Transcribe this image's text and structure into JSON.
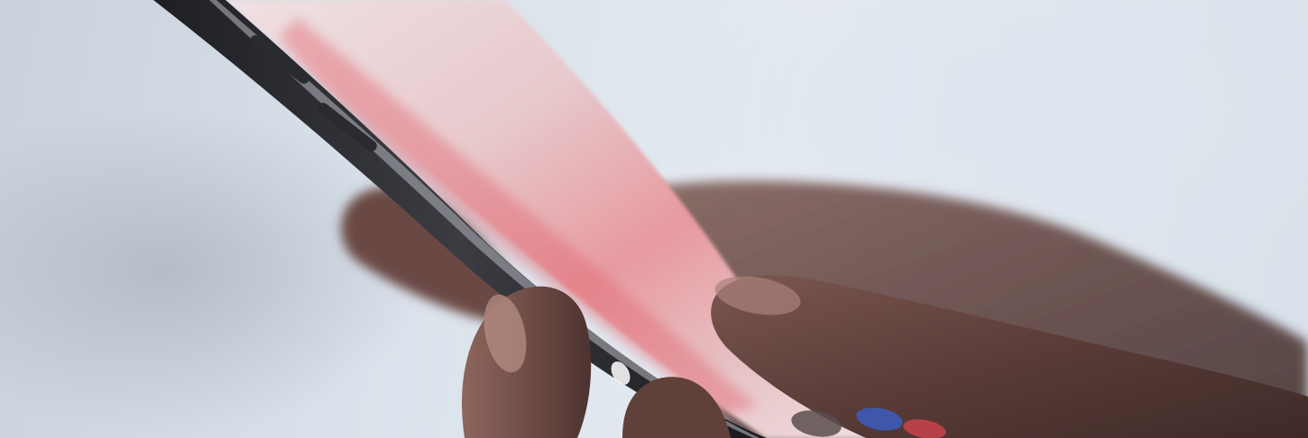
{
  "image": {
    "subject": "hand-holding-smartphone-photo",
    "colors": {
      "background_light": "#e3e9f0",
      "background_shadow": "#aab2be",
      "phone_frame": "#2b2c31",
      "phone_screen": "#e2c6c9",
      "screen_accent_red": "#e0606a",
      "skin_dark": "#4a3230",
      "skin_mid": "#6e4a45",
      "skin_highlight": "#a27a72"
    }
  }
}
